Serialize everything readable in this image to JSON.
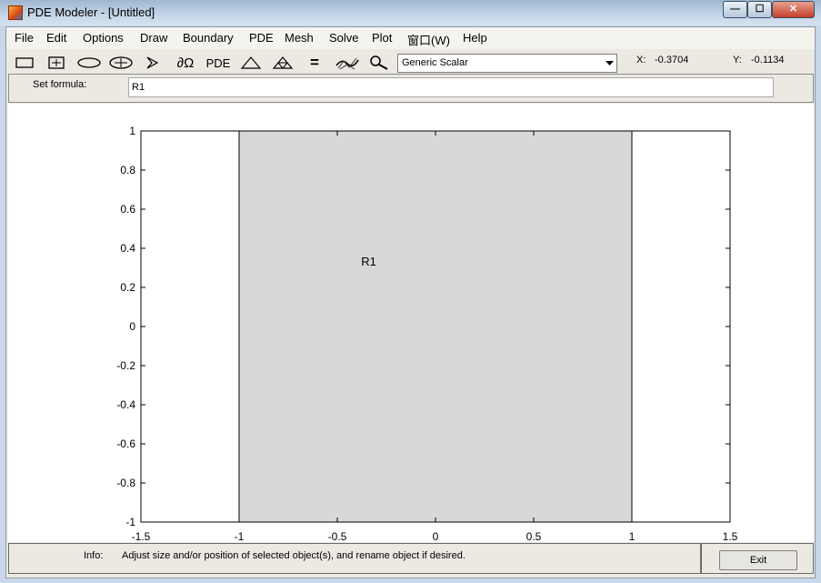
{
  "window": {
    "title": "PDE Modeler - [Untitled]",
    "controls": {
      "minimize": "—",
      "maximize": "☐",
      "close": "✕"
    }
  },
  "menu": [
    "File",
    "Edit",
    "Options",
    "Draw",
    "Boundary",
    "PDE",
    "Mesh",
    "Solve",
    "Plot",
    "窗口(W)",
    "Help"
  ],
  "toolbar": {
    "icons": [
      "rectangle-icon",
      "centered-rectangle-icon",
      "ellipse-icon",
      "centered-ellipse-icon",
      "polygon-icon",
      "boundary-mode-icon",
      "pde-spec-icon",
      "init-mesh-icon",
      "refine-mesh-icon",
      "solve-icon",
      "plot-icon",
      "zoom-icon"
    ],
    "boundary_symbol": "∂Ω",
    "pde_label": "PDE",
    "solve_symbol": "="
  },
  "app_mode": {
    "selected": "Generic Scalar"
  },
  "coordinates": {
    "x_label": "X:",
    "x_value": "-0.3704",
    "y_label": "Y:",
    "y_value": "-0.1134"
  },
  "formula": {
    "label": "Set formula:",
    "value": "R1"
  },
  "plot": {
    "xlim": [
      -1.5,
      1.5
    ],
    "ylim": [
      -1,
      1
    ],
    "x_ticks": [
      "-1.5",
      "-1",
      "-0.5",
      "0",
      "0.5",
      "1",
      "1.5"
    ],
    "y_ticks": [
      "1",
      "0.8",
      "0.6",
      "0.4",
      "0.2",
      "0",
      "-0.2",
      "-0.4",
      "-0.6",
      "-0.8",
      "-1"
    ],
    "shape": {
      "name": "R1",
      "x_range": [
        -1,
        1
      ],
      "y_range": [
        -1,
        1
      ],
      "label_at": [
        -0.34,
        0.33
      ],
      "fill": "#d8d8d8"
    }
  },
  "info": {
    "label": "Info:",
    "text": "Adjust size and/or position of selected object(s), and rename object if desired."
  },
  "exit_label": "Exit"
}
